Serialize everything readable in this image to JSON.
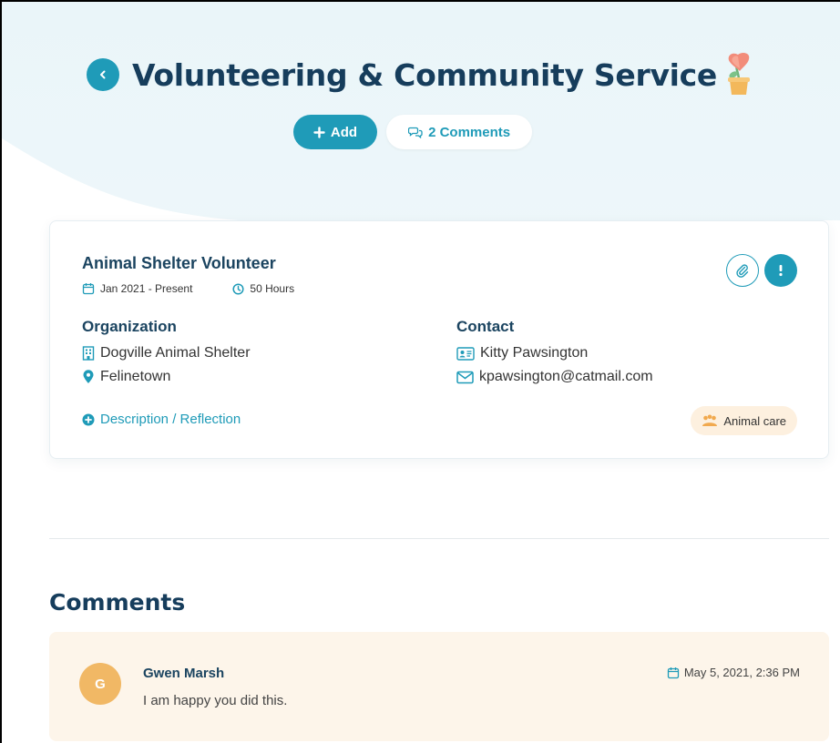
{
  "header": {
    "title": "Volunteering & Community Service",
    "add_label": "Add",
    "comments_label": "2 Comments"
  },
  "entry": {
    "title": "Animal Shelter Volunteer",
    "date_range": "Jan 2021 - Present",
    "hours": "50 Hours",
    "organization_heading": "Organization",
    "organization_name": "Dogville Animal Shelter",
    "organization_location": "Felinetown",
    "contact_heading": "Contact",
    "contact_name": "Kitty Pawsington",
    "contact_email": "kpawsington@catmail.com",
    "description_link": "Description / Reflection",
    "tag": "Animal care"
  },
  "comments": {
    "heading": "Comments",
    "items": [
      {
        "initial": "G",
        "author": "Gwen Marsh",
        "date": "May 5, 2021, 2:36 PM",
        "text": "I am happy you did this."
      }
    ]
  },
  "colors": {
    "accent": "#1f9bb8",
    "heading": "#163d5c",
    "hero_bg": "#eaf5f9",
    "comment_bg": "#fdf5ea",
    "avatar": "#f1b865",
    "tag_bg": "#fdf0df"
  },
  "icons": {
    "back": "chevron-left-icon",
    "add": "plus-icon",
    "comments": "chat-bubbles-icon",
    "calendar": "calendar-icon",
    "clock": "clock-icon",
    "building": "building-icon",
    "location": "map-pin-icon",
    "contact_card": "id-card-icon",
    "email": "envelope-icon",
    "attach": "paperclip-icon",
    "more": "more-vertical-icon",
    "expand": "plus-circle-icon",
    "tag": "paw-group-icon",
    "flower": "potted-flower-icon"
  }
}
